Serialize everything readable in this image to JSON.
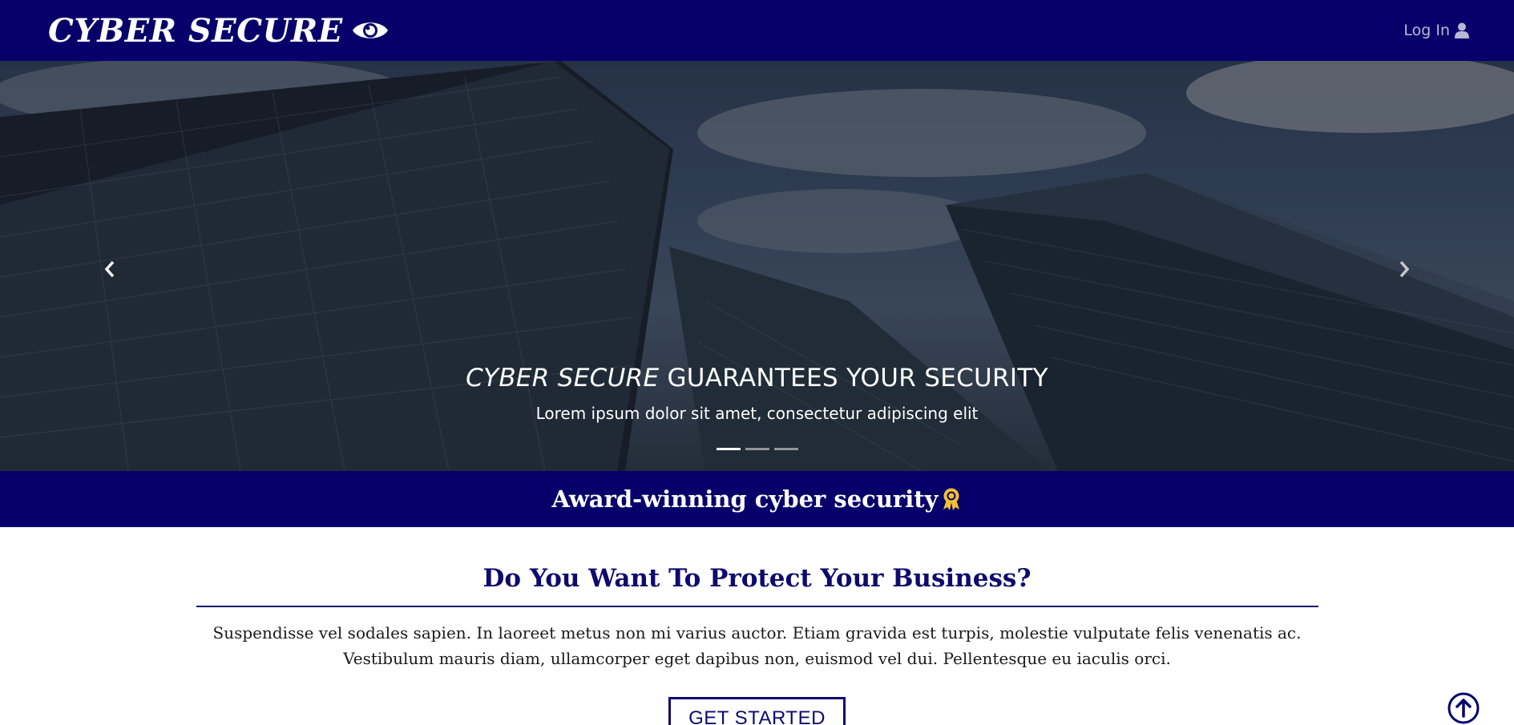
{
  "navbar": {
    "brand": "CYBER SECURE",
    "brand_icon": "eye-icon",
    "login_label": "Log In",
    "login_icon": "user-icon"
  },
  "hero": {
    "caption_brand": "CYBER SECURE",
    "caption_rest": " GUARANTEES YOUR SECURITY",
    "caption_sub": "Lorem ipsum dolor sit amet, consectetur adipiscing elit",
    "slides": 3,
    "active_slide": 1,
    "prev_icon": "chevron-left-icon",
    "next_icon": "chevron-right-icon"
  },
  "award": {
    "text": "Award-winning cyber security",
    "icon": "award-ribbon-icon"
  },
  "section": {
    "title": "Do You Want To Protect Your Business?",
    "text": "Suspendisse vel sodales sapien. In laoreet metus non mi varius auctor. Etiam gravida est turpis, molestie vulputate felis venenatis ac. Vestibulum mauris diam, ullamcorper eget dapibus non, euismod vel dui. Pellentesque eu iaculis orci.",
    "button": "GET STARTED"
  },
  "scroll_top_icon": "arrow-up-circle-icon",
  "colors": {
    "primary": "#07006b",
    "heading": "#0e0a6e",
    "award_gold": "#f2c230"
  }
}
